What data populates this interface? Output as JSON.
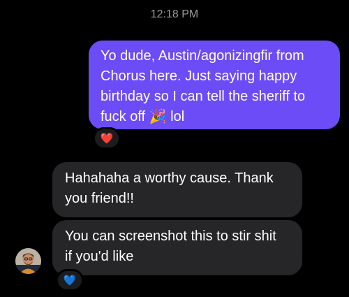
{
  "conversation": {
    "timestamp": "12:18 PM",
    "messages": [
      {
        "direction": "outgoing",
        "text": "Yo dude, Austin/agonizingfir from\nChorus here. Just saying happy\nbirthday so I can tell the sheriff to\nfuck off 🎉 lol",
        "reaction": "❤️"
      },
      {
        "direction": "incoming",
        "text": "Hahahaha a worthy cause. Thank\nyou friend!!"
      },
      {
        "direction": "incoming",
        "text": "You can screenshot this to stir shit\nif you'd like",
        "reaction": "💙"
      }
    ]
  },
  "colors": {
    "outgoing_bubble": "#6b4cf6",
    "incoming_bubble": "#262628",
    "background": "#000000"
  },
  "icons": {
    "reaction_1": "red-heart-icon",
    "reaction_2": "blue-heart-icon",
    "avatar": "contact-avatar"
  }
}
